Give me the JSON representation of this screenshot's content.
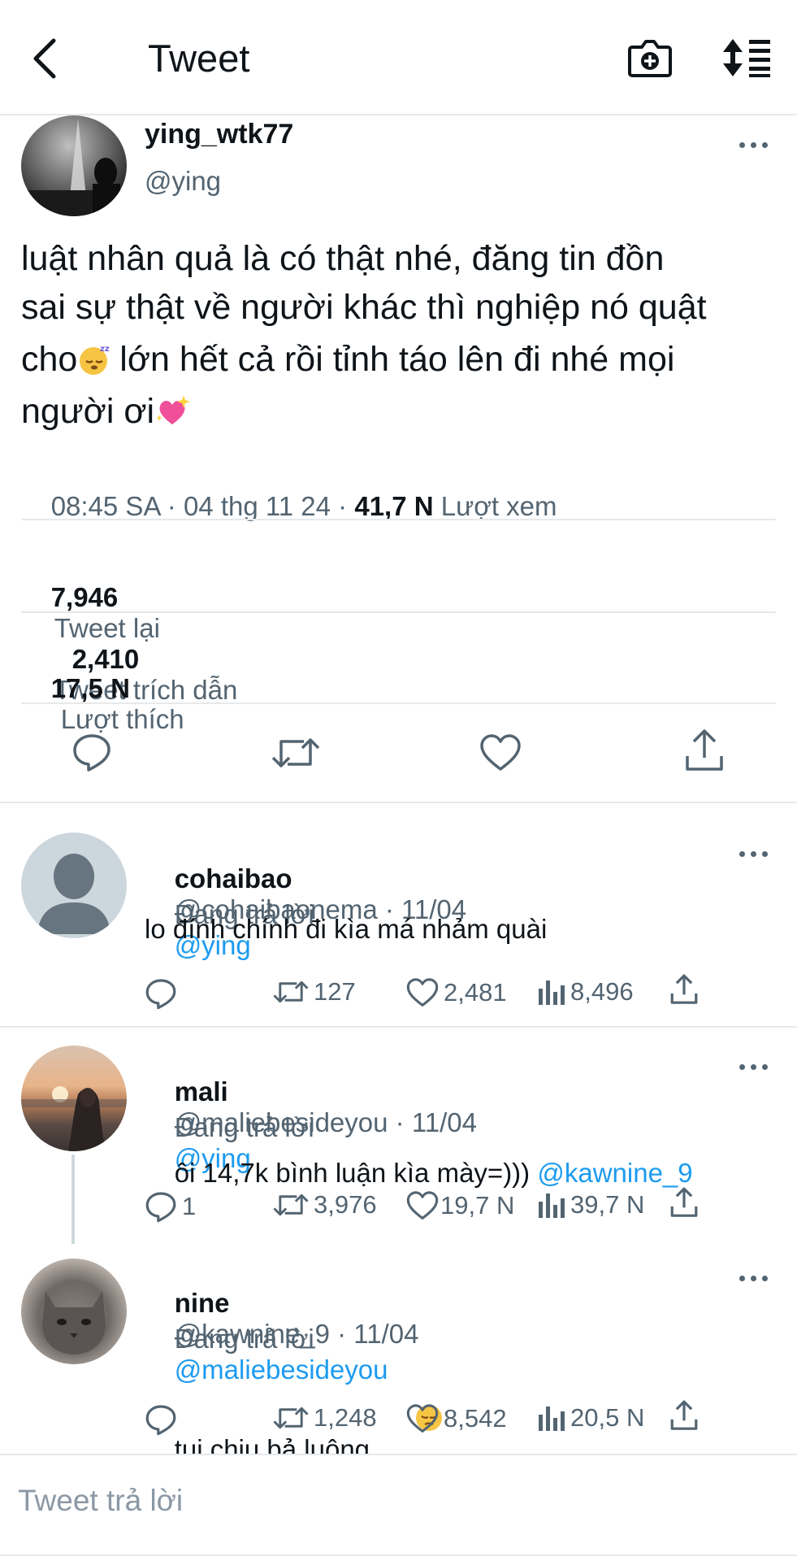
{
  "header": {
    "title": "Tweet",
    "icons": [
      "back-arrow-icon",
      "camera-add-icon",
      "sort-icon"
    ]
  },
  "tweet": {
    "display_name": "ying_wtk77",
    "handle": "@ying",
    "text_line1": "luật nhân quả là có thật nhé, đăng tin đồn",
    "text_line2": "sai sự thật về người khác thì nghiệp nó quật",
    "text_line3a": "cho",
    "text_line3b": " lớn hết cả rồi tỉnh táo lên đi nhé mọi",
    "text_line4": "người ơi",
    "emojis": [
      "sleeping-face-emoji",
      "sparkling-heart-emoji"
    ],
    "meta_time": "08:45 SA · 04 thg 11 24 · ",
    "views_count": "41,7 N",
    "views_label": " Lượt xem",
    "retweets_count": "7,946",
    "retweets_label": "Tweet lại",
    "quotes_count": "2,410",
    "quotes_label": "Tweet trích dẫn",
    "likes_count": "17,5 N",
    "likes_label": "Lượt thích",
    "action_icons": [
      "reply-icon",
      "retweet-icon",
      "like-icon",
      "share-icon"
    ]
  },
  "replies": [
    {
      "name": "cohaibao",
      "handle_date": "@cohaibaonema · 11/04",
      "replying_label": "Đang trả lời",
      "replying_to": "@ying",
      "text": "lo đính chính đi kìa má nhảm quài",
      "mention": "",
      "reply_count": "",
      "retweet_count": "127",
      "like_count": "2,481",
      "view_count": "8,496"
    },
    {
      "name": "mali",
      "handle_date": "@maliebesideyou · 11/04",
      "replying_label": "Đang trả lời",
      "replying_to": "@ying",
      "text": "ôi 14,7k bình luận kìa mày=))) ",
      "mention": "@kawnine_9",
      "reply_count": "1",
      "retweet_count": "3,976",
      "like_count": "19,7 N",
      "view_count": "39,7 N"
    },
    {
      "name": "nine",
      "handle_date": "@kawnine_9 · 11/04",
      "replying_label": "Đang trả lời",
      "replying_to": "@maliebesideyou",
      "text": "tui chịu bả luông",
      "emoji": "pensive-face-emoji",
      "reply_count": "",
      "retweet_count": "1,248",
      "like_count": "8,542",
      "view_count": "20,5 N"
    }
  ],
  "composer": {
    "placeholder": "Tweet trả lời"
  },
  "colors": {
    "accent": "#1d9bf0",
    "text": "#0f1419",
    "secondary": "#536471",
    "divider": "#e6e9ec"
  }
}
